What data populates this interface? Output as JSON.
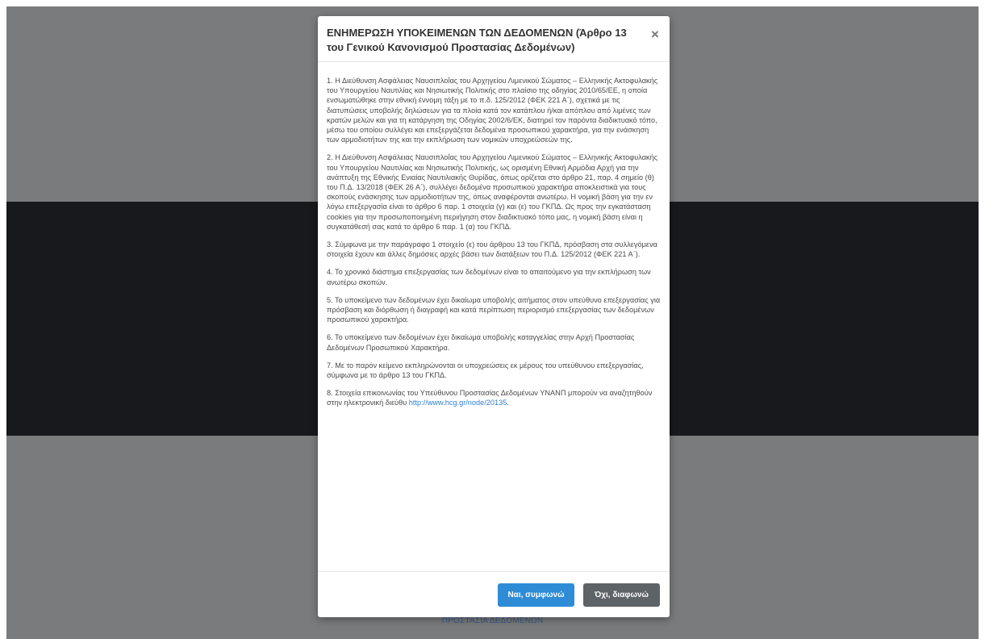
{
  "colors": {
    "backdrop_gray": "#797b7c",
    "backdrop_dark": "#17191c",
    "accept_button": "#2e8bd6",
    "decline_button": "#5e6368",
    "link": "#2d7fd1"
  },
  "background": {
    "footer_link_partial": "ΠΡΟΣΤΑΣΙΑ ΔΕΔΟΜΕΝΩΝ"
  },
  "modal": {
    "title": "ΕΝΗΜΕΡΩΣΗ ΥΠΟΚΕΙΜΕΝΩΝ ΤΩΝ ΔΕΔΟΜΕΝΩΝ (Άρθρο 13 του Γενικού Κανονισμού Προστασίας Δεδομένων)",
    "close_label": "×",
    "close_icon": "close-icon",
    "paragraphs": [
      "1. Η Διεύθυνση Ασφάλειας Ναυσιπλοΐας του Αρχηγείου Λιμενικού Σώματος – Ελληνικής Ακτοφυλακής του Υπουργείου Ναυτιλίας και Νησιωτικής Πολιτικής στο πλαίσιο της οδηγίας 2010/65/ΕΕ, η οποία ενσωματώθηκε στην εθνική έννομη τάξη με το π.δ. 125/2012 (ΦΕΚ 221 Α΄), σχετικά με τις διατυπώσεις υποβολής δηλώσεων για τα πλοία κατά τον κατάπλου ή/και απόπλου από λιμένες των κρατών μελών και για τη κατάργηση της Οδηγίας 2002/6/ΕΚ, διατηρεί τον παρόντα διαδικτυακό τόπο, μέσω του οποίου συλλέγει και επεξεργάζεται δεδομένα προσωπικού χαρακτήρα, για την ενάσκηση των αρμοδιοτήτων της και την εκπλήρωση των νομικών υποχρεώσεών της.",
      "2. Η Διεύθυνση Ασφάλειας Ναυσιπλοΐας του Αρχηγείου Λιμενικού Σώματος – Ελληνικής Ακτοφυλακής του Υπουργείου Ναυτιλίας και Νησιωτικής Πολιτικής, ως ορισμένη Εθνική Αρμόδια Αρχή για την ανάπτυξη της Εθνικής Ενιαίας Ναυτιλιακής Θυρίδας, όπως ορίζεται στο άρθρο 21, παρ. 4 σημείο (θ) του Π.Δ. 13/2018 (ΦΕΚ 26 Α΄), συλλέγει δεδομένα προσωπικού χαρακτήρα αποκλειστικά για τους σκοπούς ενάσκησης των αρμοδιοτήτων της, όπως αναφέρονται ανωτέρω. Η νομική βάση για την εν λόγω επεξεργασία είναι το άρθρο 6 παρ. 1 στοιχεία (γ) και (ε) του ΓΚΠΔ. Ως προς την εγκατάσταση cookies για την προσωποποιημένη περιήγηση στον διαδικτυακό τόπο μας, η νομική βάση είναι η συγκατάθεσή σας κατά το άρθρο 6 παρ. 1 (α) του ΓΚΠΔ.",
      "3. Σύμφωνα με την παράγραφο 1 στοιχείο (ε) του άρθρου 13 του ΓΚΠΔ, πρόσβαση στα συλλεγόμενα στοιχεία έχουν και άλλες δημόσιες αρχές βάσει των διατάξεων του Π.Δ. 125/2012 (ΦΕΚ 221 Α΄).",
      "4. Το χρονικό διάστημα επεξεργασίας των δεδομένων είναι το απαιτούμενο για την εκπλήρωση των ανωτέρω σκοπών.",
      "5. Το υποκείμενο των δεδομένων έχει δικαίωμα υποβολής αιτήματος στον υπεύθυνο επεξεργασίας για πρόσβαση και διόρθωση ή διαγραφή και κατά περίπτωση περιορισμό επεξεργασίας των δεδομένων προσωπικού χαρακτήρα.",
      "6. Το υποκείμενο των δεδομένων έχει δικαίωμα υποβολής καταγγελίας στην Αρχή Προστασίας Δεδομένων Προσωπικού Χαρακτήρα.",
      "7. Με το παρόν κείμενο εκπληρώνονται οι υποχρεώσεις εκ μέρους του υπεύθυνου επεξεργασίας, σύμφωνα με το άρθρο 13 του ΓΚΠΔ."
    ],
    "paragraph_8_text": "8. Στοιχεία επικοινωνίας του Υπεύθυνου Προστασίας Δεδομένων ΥΝΑΝΠ μπορούν να αναζητηθούν στην ηλεκτρονική διεύθυ ",
    "paragraph_8_link": "http://www.hcg.gr/node/20135",
    "paragraph_8_end": ".",
    "accept_label": "Ναι, συμφωνώ",
    "decline_label": "Όχι, διαφωνώ"
  }
}
